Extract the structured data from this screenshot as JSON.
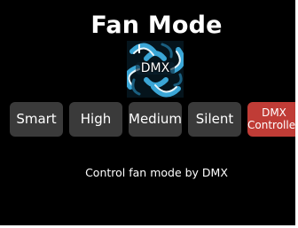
{
  "page": {
    "title": "Fan Mode",
    "background": "#000000"
  },
  "fan_image": {
    "icon": "fan-icon",
    "caption": "DMX",
    "accent": "#3ba6d6"
  },
  "modes": [
    {
      "label": "Smart",
      "active": false
    },
    {
      "label": "High",
      "active": false
    },
    {
      "label": "Medium",
      "active": false
    },
    {
      "label": "Silent",
      "active": false
    },
    {
      "label_lines": [
        "DMX",
        "Controlled"
      ],
      "active": true
    }
  ],
  "colors": {
    "button_bg": "#3a3a3a",
    "active_bg": "#c03c36",
    "text": "#ffffff"
  },
  "status": {
    "text": "Control fan mode by DMX"
  }
}
